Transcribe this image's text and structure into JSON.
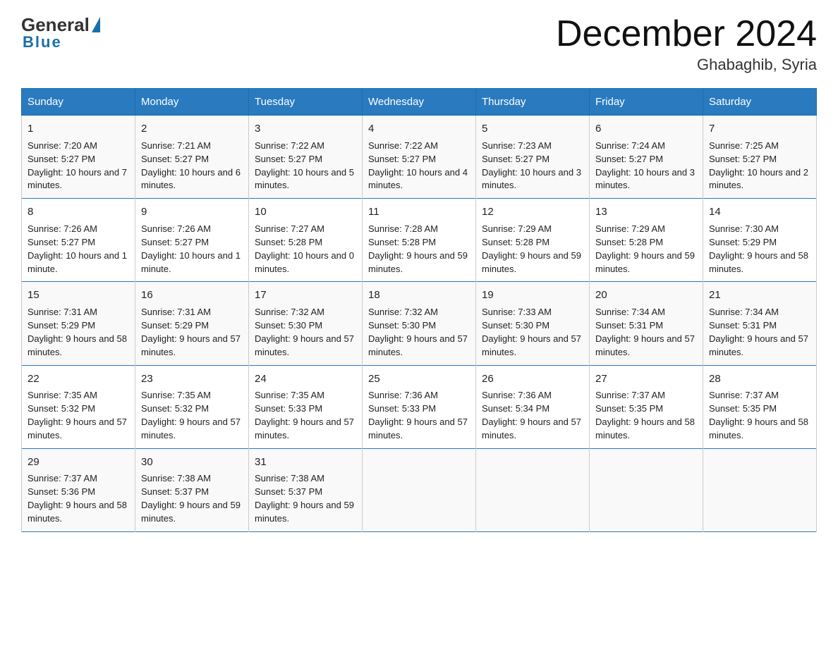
{
  "header": {
    "logo_general": "General",
    "logo_blue": "Blue",
    "title": "December 2024",
    "subtitle": "Ghabaghib, Syria"
  },
  "days_of_week": [
    "Sunday",
    "Monday",
    "Tuesday",
    "Wednesday",
    "Thursday",
    "Friday",
    "Saturday"
  ],
  "weeks": [
    [
      {
        "day": "1",
        "sunrise": "7:20 AM",
        "sunset": "5:27 PM",
        "daylight": "10 hours and 7 minutes."
      },
      {
        "day": "2",
        "sunrise": "7:21 AM",
        "sunset": "5:27 PM",
        "daylight": "10 hours and 6 minutes."
      },
      {
        "day": "3",
        "sunrise": "7:22 AM",
        "sunset": "5:27 PM",
        "daylight": "10 hours and 5 minutes."
      },
      {
        "day": "4",
        "sunrise": "7:22 AM",
        "sunset": "5:27 PM",
        "daylight": "10 hours and 4 minutes."
      },
      {
        "day": "5",
        "sunrise": "7:23 AM",
        "sunset": "5:27 PM",
        "daylight": "10 hours and 3 minutes."
      },
      {
        "day": "6",
        "sunrise": "7:24 AM",
        "sunset": "5:27 PM",
        "daylight": "10 hours and 3 minutes."
      },
      {
        "day": "7",
        "sunrise": "7:25 AM",
        "sunset": "5:27 PM",
        "daylight": "10 hours and 2 minutes."
      }
    ],
    [
      {
        "day": "8",
        "sunrise": "7:26 AM",
        "sunset": "5:27 PM",
        "daylight": "10 hours and 1 minute."
      },
      {
        "day": "9",
        "sunrise": "7:26 AM",
        "sunset": "5:27 PM",
        "daylight": "10 hours and 1 minute."
      },
      {
        "day": "10",
        "sunrise": "7:27 AM",
        "sunset": "5:28 PM",
        "daylight": "10 hours and 0 minutes."
      },
      {
        "day": "11",
        "sunrise": "7:28 AM",
        "sunset": "5:28 PM",
        "daylight": "9 hours and 59 minutes."
      },
      {
        "day": "12",
        "sunrise": "7:29 AM",
        "sunset": "5:28 PM",
        "daylight": "9 hours and 59 minutes."
      },
      {
        "day": "13",
        "sunrise": "7:29 AM",
        "sunset": "5:28 PM",
        "daylight": "9 hours and 59 minutes."
      },
      {
        "day": "14",
        "sunrise": "7:30 AM",
        "sunset": "5:29 PM",
        "daylight": "9 hours and 58 minutes."
      }
    ],
    [
      {
        "day": "15",
        "sunrise": "7:31 AM",
        "sunset": "5:29 PM",
        "daylight": "9 hours and 58 minutes."
      },
      {
        "day": "16",
        "sunrise": "7:31 AM",
        "sunset": "5:29 PM",
        "daylight": "9 hours and 57 minutes."
      },
      {
        "day": "17",
        "sunrise": "7:32 AM",
        "sunset": "5:30 PM",
        "daylight": "9 hours and 57 minutes."
      },
      {
        "day": "18",
        "sunrise": "7:32 AM",
        "sunset": "5:30 PM",
        "daylight": "9 hours and 57 minutes."
      },
      {
        "day": "19",
        "sunrise": "7:33 AM",
        "sunset": "5:30 PM",
        "daylight": "9 hours and 57 minutes."
      },
      {
        "day": "20",
        "sunrise": "7:34 AM",
        "sunset": "5:31 PM",
        "daylight": "9 hours and 57 minutes."
      },
      {
        "day": "21",
        "sunrise": "7:34 AM",
        "sunset": "5:31 PM",
        "daylight": "9 hours and 57 minutes."
      }
    ],
    [
      {
        "day": "22",
        "sunrise": "7:35 AM",
        "sunset": "5:32 PM",
        "daylight": "9 hours and 57 minutes."
      },
      {
        "day": "23",
        "sunrise": "7:35 AM",
        "sunset": "5:32 PM",
        "daylight": "9 hours and 57 minutes."
      },
      {
        "day": "24",
        "sunrise": "7:35 AM",
        "sunset": "5:33 PM",
        "daylight": "9 hours and 57 minutes."
      },
      {
        "day": "25",
        "sunrise": "7:36 AM",
        "sunset": "5:33 PM",
        "daylight": "9 hours and 57 minutes."
      },
      {
        "day": "26",
        "sunrise": "7:36 AM",
        "sunset": "5:34 PM",
        "daylight": "9 hours and 57 minutes."
      },
      {
        "day": "27",
        "sunrise": "7:37 AM",
        "sunset": "5:35 PM",
        "daylight": "9 hours and 58 minutes."
      },
      {
        "day": "28",
        "sunrise": "7:37 AM",
        "sunset": "5:35 PM",
        "daylight": "9 hours and 58 minutes."
      }
    ],
    [
      {
        "day": "29",
        "sunrise": "7:37 AM",
        "sunset": "5:36 PM",
        "daylight": "9 hours and 58 minutes."
      },
      {
        "day": "30",
        "sunrise": "7:38 AM",
        "sunset": "5:37 PM",
        "daylight": "9 hours and 59 minutes."
      },
      {
        "day": "31",
        "sunrise": "7:38 AM",
        "sunset": "5:37 PM",
        "daylight": "9 hours and 59 minutes."
      },
      null,
      null,
      null,
      null
    ]
  ],
  "labels": {
    "sunrise": "Sunrise:",
    "sunset": "Sunset:",
    "daylight": "Daylight:"
  }
}
